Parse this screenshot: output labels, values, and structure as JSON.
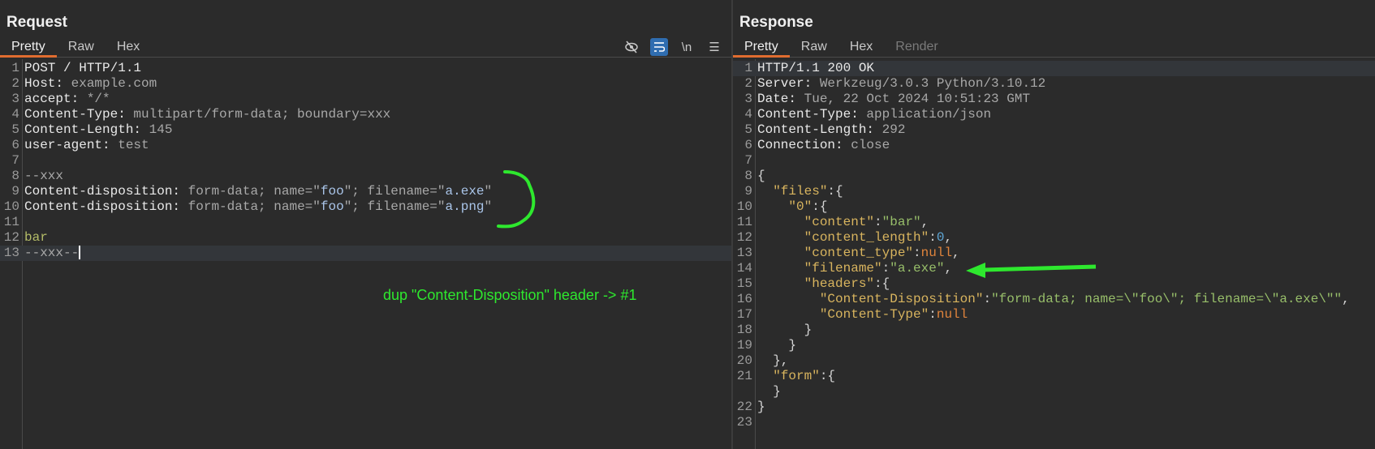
{
  "request": {
    "title": "Request",
    "tabs": [
      {
        "label": "Pretty",
        "active": true
      },
      {
        "label": "Raw"
      },
      {
        "label": "Hex"
      }
    ],
    "tools": {
      "newline_label": "\\n"
    },
    "lines": [
      [
        [
          "h",
          "POST / HTTP/1.1"
        ]
      ],
      [
        [
          "h",
          "Host: "
        ],
        [
          "v",
          "example.com"
        ]
      ],
      [
        [
          "h",
          "accept: "
        ],
        [
          "v",
          "*/*"
        ]
      ],
      [
        [
          "h",
          "Content-Type: "
        ],
        [
          "v",
          "multipart/form-data; boundary=xxx"
        ]
      ],
      [
        [
          "h",
          "Content-Length: "
        ],
        [
          "v",
          "145"
        ]
      ],
      [
        [
          "h",
          "user-agent: "
        ],
        [
          "v",
          "test"
        ]
      ],
      [],
      [
        [
          "v",
          "--xxx"
        ]
      ],
      [
        [
          "h",
          "Content-disposition: "
        ],
        [
          "v",
          "form-data; name=\""
        ],
        [
          "q",
          "foo"
        ],
        [
          "v",
          "\"; filename=\""
        ],
        [
          "q",
          "a.exe"
        ],
        [
          "v",
          "\""
        ]
      ],
      [
        [
          "h",
          "Content-disposition: "
        ],
        [
          "v",
          "form-data; name=\""
        ],
        [
          "q",
          "foo"
        ],
        [
          "v",
          "\"; filename=\""
        ],
        [
          "q",
          "a.png"
        ],
        [
          "v",
          "\""
        ]
      ],
      [],
      [
        [
          "b",
          "bar"
        ]
      ],
      [
        [
          "v",
          "--xxx--"
        ]
      ]
    ],
    "annotation": "dup \"Content-Disposition\" header -> #1"
  },
  "response": {
    "title": "Response",
    "tabs": [
      {
        "label": "Pretty",
        "active": true
      },
      {
        "label": "Raw"
      },
      {
        "label": "Hex"
      },
      {
        "label": "Render",
        "disabled": true
      }
    ],
    "lines": [
      [
        [
          "h",
          "HTTP/1.1 200 OK"
        ]
      ],
      [
        [
          "h",
          "Server: "
        ],
        [
          "v",
          "Werkzeug/3.0.3 Python/3.10.12"
        ]
      ],
      [
        [
          "h",
          "Date: "
        ],
        [
          "v",
          "Tue, 22 Oct 2024 10:51:23 GMT"
        ]
      ],
      [
        [
          "h",
          "Content-Type: "
        ],
        [
          "v",
          "application/json"
        ]
      ],
      [
        [
          "h",
          "Content-Length: "
        ],
        [
          "v",
          "292"
        ]
      ],
      [
        [
          "h",
          "Connection: "
        ],
        [
          "v",
          "close"
        ]
      ],
      [],
      [
        [
          "p",
          "{"
        ]
      ],
      [
        [
          "p",
          "  "
        ],
        [
          "k",
          "\"files\""
        ],
        [
          "p",
          ":{"
        ]
      ],
      [
        [
          "p",
          "    "
        ],
        [
          "k",
          "\"0\""
        ],
        [
          "p",
          ":{"
        ]
      ],
      [
        [
          "p",
          "      "
        ],
        [
          "k",
          "\"content\""
        ],
        [
          "p",
          ":"
        ],
        [
          "s",
          "\"bar\""
        ],
        [
          "p",
          ","
        ]
      ],
      [
        [
          "p",
          "      "
        ],
        [
          "k",
          "\"content_length\""
        ],
        [
          "p",
          ":"
        ],
        [
          "num",
          "0"
        ],
        [
          "p",
          ","
        ]
      ],
      [
        [
          "p",
          "      "
        ],
        [
          "k",
          "\"content_type\""
        ],
        [
          "p",
          ":"
        ],
        [
          "n",
          "null"
        ],
        [
          "p",
          ","
        ]
      ],
      [
        [
          "p",
          "      "
        ],
        [
          "k",
          "\"filename\""
        ],
        [
          "p",
          ":"
        ],
        [
          "s",
          "\"a.exe\""
        ],
        [
          "p",
          ","
        ]
      ],
      [
        [
          "p",
          "      "
        ],
        [
          "k",
          "\"headers\""
        ],
        [
          "p",
          ":{"
        ]
      ],
      [
        [
          "p",
          "        "
        ],
        [
          "k",
          "\"Content-Disposition\""
        ],
        [
          "p",
          ":"
        ],
        [
          "s",
          "\"form-data; name=\\\"foo\\\"; filename=\\\"a.exe\\\"\""
        ],
        [
          "p",
          ","
        ]
      ],
      [
        [
          "p",
          "        "
        ],
        [
          "k",
          "\"Content-Type\""
        ],
        [
          "p",
          ":"
        ],
        [
          "n",
          "null"
        ]
      ],
      [
        [
          "p",
          "      }"
        ]
      ],
      [
        [
          "p",
          "    }"
        ]
      ],
      [
        [
          "p",
          "  },"
        ]
      ],
      [
        [
          "p",
          "  "
        ],
        [
          "k",
          "\"form\""
        ],
        [
          "p",
          ":{"
        ]
      ],
      [
        [
          "p",
          "  }"
        ]
      ],
      [
        [
          "p",
          "}"
        ]
      ],
      []
    ],
    "line_numbers": [
      "1",
      "2",
      "3",
      "4",
      "5",
      "6",
      "7",
      "8",
      "9",
      "10",
      "11",
      "12",
      "13",
      "14",
      "15",
      "16",
      "17",
      "18",
      "19",
      "20",
      "21",
      "",
      "22",
      "23"
    ]
  },
  "colors": {
    "accent": "#e06c30",
    "annotation": "#2ee82e",
    "background": "#2b2b2b"
  }
}
